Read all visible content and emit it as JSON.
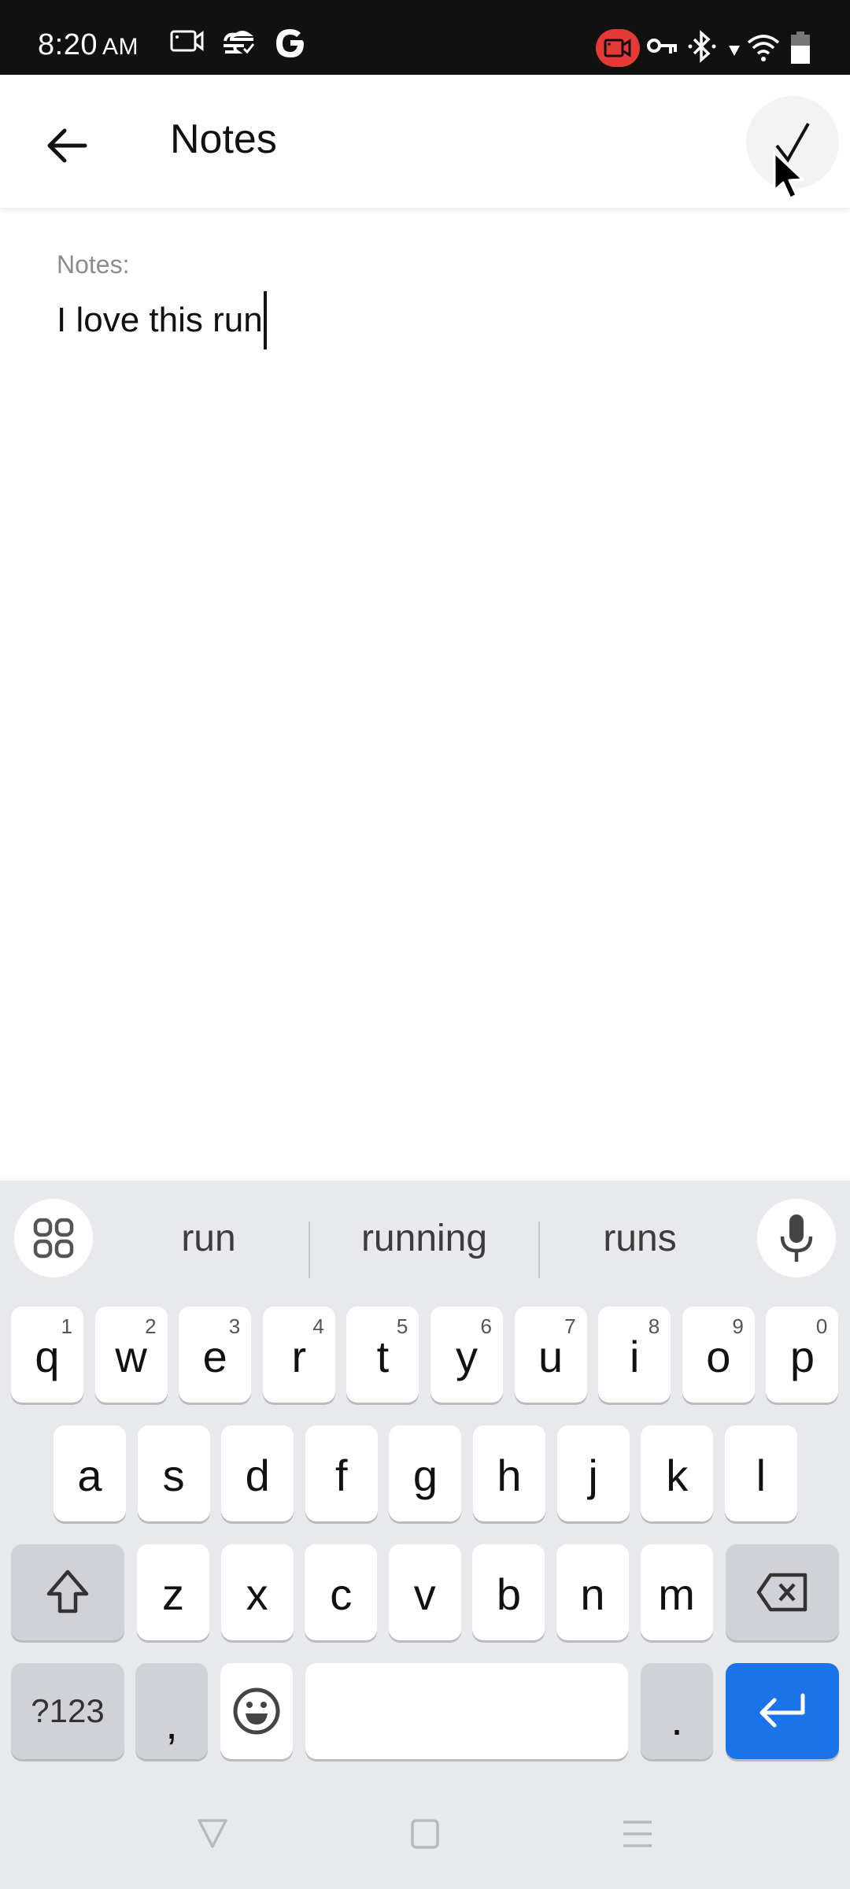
{
  "status_bar": {
    "time": "8:20",
    "ampm": "AM",
    "left_icons": [
      "screen-record-icon",
      "cloud-sync-icon",
      "google-icon"
    ],
    "right_icons": [
      "recording-badge-icon",
      "vpn-key-icon",
      "bluetooth-icon",
      "data-arrow-icon",
      "wifi-icon",
      "battery-icon"
    ],
    "recording_color": "#e53935"
  },
  "header": {
    "title": "Notes",
    "back_icon": "arrow-left-icon",
    "done_icon": "check-icon"
  },
  "form": {
    "label": "Notes:",
    "value": "I love this run"
  },
  "keyboard": {
    "suggestions": [
      "run",
      "running",
      "runs"
    ],
    "row1": [
      {
        "k": "q",
        "h": "1"
      },
      {
        "k": "w",
        "h": "2"
      },
      {
        "k": "e",
        "h": "3"
      },
      {
        "k": "r",
        "h": "4"
      },
      {
        "k": "t",
        "h": "5"
      },
      {
        "k": "y",
        "h": "6"
      },
      {
        "k": "u",
        "h": "7"
      },
      {
        "k": "i",
        "h": "8"
      },
      {
        "k": "o",
        "h": "9"
      },
      {
        "k": "p",
        "h": "0"
      }
    ],
    "row2": [
      "a",
      "s",
      "d",
      "f",
      "g",
      "h",
      "j",
      "k",
      "l"
    ],
    "row3": [
      "z",
      "x",
      "c",
      "v",
      "b",
      "n",
      "m"
    ],
    "symbols_label": "?123",
    "comma_label": ",",
    "period_label": ".",
    "enter_color": "#1a73e8"
  },
  "navbar": {
    "buttons": [
      "back-triangle-icon",
      "home-square-icon",
      "recents-menu-icon"
    ]
  }
}
